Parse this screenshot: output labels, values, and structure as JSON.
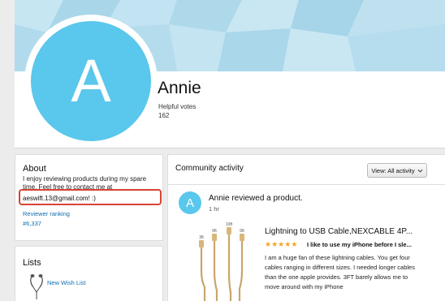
{
  "profile": {
    "name": "Annie",
    "avatar_initial": "A",
    "helpful_votes_label": "Helpful votes",
    "helpful_votes_count": "162"
  },
  "about": {
    "title": "About",
    "text": "I enjoy reviewing products during my spare time. Feel free to contact me at",
    "email": "aeswift.13@gmail.com! :)",
    "reviewer_ranking_label": "Reviewer ranking",
    "reviewer_ranking_value": "#6,337"
  },
  "lists": {
    "title": "Lists",
    "items": [
      {
        "label": "New Wish List",
        "icon": "earphones-icon"
      }
    ]
  },
  "activity": {
    "title": "Community activity",
    "view_select": "View: All activity",
    "entry": {
      "avatar_initial": "A",
      "headline": "Annie reviewed a product.",
      "time": "1 hr",
      "product_title": "Lightning to USB Cable,NEXCABLE 4P...",
      "rating": 5,
      "review_title": "I like to use my iPhone before I sle...",
      "review_body": "I am a huge fan of these lightning cables. You get four cables ranging in different sizes. I needed longer cables than the one apple provides. 3FT barely allows me to move around with my iPhone",
      "cable_labels": [
        "3ft",
        "6ft",
        "10ft",
        "6ft"
      ]
    }
  },
  "colors": {
    "avatar": "#5ac7ec",
    "link": "#0f6dae",
    "highlight": "#d84334",
    "star": "#f5a623",
    "cable": "#c9a66b"
  }
}
